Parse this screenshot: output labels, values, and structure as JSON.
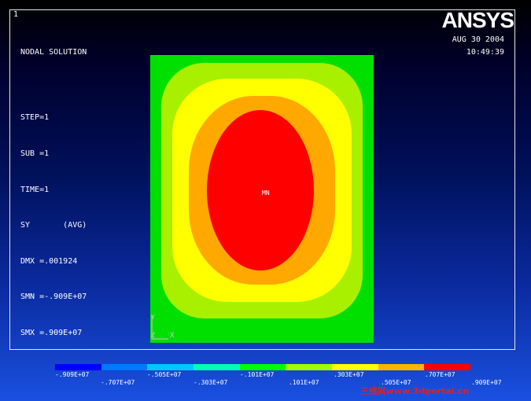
{
  "window_number": "1",
  "logo": "ANSYS",
  "date": "AUG 30 2004",
  "time": "10:49:39",
  "info": {
    "title": "NODAL SOLUTION",
    "step": "STEP=1",
    "sub": "SUB =1",
    "time": "TIME=1",
    "sy": "SY       (AVG)",
    "dmx": "DMX =.001924",
    "smn": "SMN =-.909E+07",
    "smx": "SMX =.909E+07"
  },
  "min_marker": "MN",
  "axis": {
    "y": "Y",
    "z": "Z",
    "x": "X"
  },
  "legend": {
    "colors": [
      "#0000ff",
      "#0078ff",
      "#00c8ff",
      "#00ffb4",
      "#00ff00",
      "#a0ff00",
      "#ffff00",
      "#ffb400",
      "#ff0000"
    ],
    "labels_top": [
      ".909E+07",
      ".505E+07",
      ".101E+07",
      ".303E+07",
      ".707E+07"
    ],
    "labels_top_sign": [
      "-",
      "-",
      "-",
      "",
      ""
    ],
    "labels_bottom": [
      "-.707E+07",
      "-.303E+07",
      ".101E+07",
      ".505E+07",
      ".909E+07"
    ]
  },
  "contour_colors": [
    "#00e000",
    "#a8f000",
    "#ffff00",
    "#ffa800",
    "#ff0000"
  ],
  "watermark": "三维网www.3dportal.cn"
}
